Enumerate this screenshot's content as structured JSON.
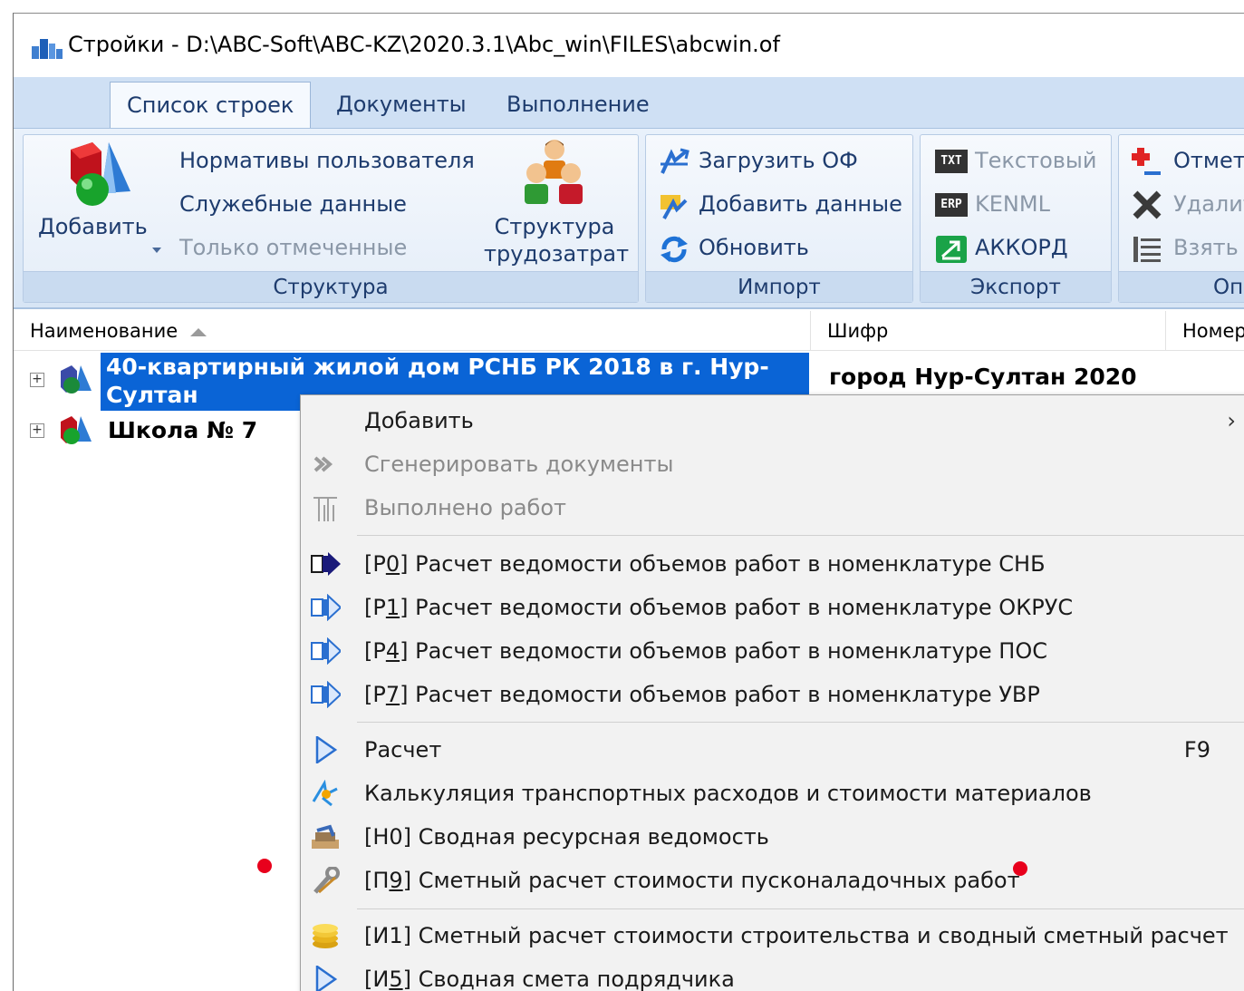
{
  "window": {
    "title": "Стройки - D:\\ABC-Soft\\ABC-KZ\\2020.3.1\\Abc_win\\FILES\\abcwin.of"
  },
  "tabs": [
    {
      "label": "Список строек"
    },
    {
      "label": "Документы"
    },
    {
      "label": "Выполнение"
    }
  ],
  "ribbon": {
    "structure": {
      "label": "Структура",
      "add": "Добавить",
      "user_norms": "Нормативы пользователя",
      "service_data": "Служебные данные",
      "only_marked": "Только отмеченные",
      "labor_line1": "Структура",
      "labor_line2": "трудозатрат"
    },
    "import": {
      "label": "Импорт",
      "load": "Загрузить ОФ",
      "add_data": "Добавить данные",
      "refresh": "Обновить"
    },
    "export": {
      "label": "Экспорт",
      "text": "Текстовый",
      "kenml": "KENML",
      "akkord": "АККОРД",
      "txt_badge": "TXT",
      "erp_badge": "ERP"
    },
    "op": {
      "label": "Оп",
      "mark": "Отмет",
      "delete": "Удалит",
      "take": "Взять"
    }
  },
  "grid": {
    "columns": [
      "Наименование",
      "Шифр",
      "Номер"
    ],
    "rows": [
      {
        "name_line1": "40-квартирный жилой дом РСНБ РК 2018 в г. Нур-",
        "name_line2": "Султан",
        "cipher": "город Нур-Султан 2020"
      },
      {
        "name": "Школа № 7"
      }
    ]
  },
  "context_menu": {
    "add": "Добавить",
    "generate": "Сгенерировать документы",
    "done_work": "Выполнено работ",
    "p0_pre": "[Р",
    "p0_key": "0",
    "p0_post": "] Расчет ведомости объемов работ в номенклатуре СНБ",
    "p1_pre": "[Р",
    "p1_key": "1",
    "p1_post": "] Расчет ведомости объемов работ в номенклатуре ОКРУС",
    "p4_pre": "[Р",
    "p4_key": "4",
    "p4_post": "] Расчет ведомости объемов работ в номенклатуре ПОС",
    "p7_pre": "[Р",
    "p7_key": "7",
    "p7_post": "] Расчет ведомости объемов работ в номенклатуре УВР",
    "calc": "Расчет",
    "calc_shortcut": "F9",
    "transport": "Калькуляция транспортных расходов и стоимости материалов",
    "h0": "[Н0] Сводная ресурсная ведомость",
    "p9_pre": "[П",
    "p9_key": "9",
    "p9_post": "] Сметный расчет стоимости пусконаладочных работ",
    "i1": "[И1] Сметный расчет стоимости строительства и сводный сметный расчет",
    "i5_pre": "[И",
    "i5_key": "5",
    "i5_post": "] Сводная смета подрядчика"
  },
  "colors": {
    "selection": "#0a64d6",
    "ribbon_text": "#1e3c6e",
    "marker": "#e8001c"
  }
}
